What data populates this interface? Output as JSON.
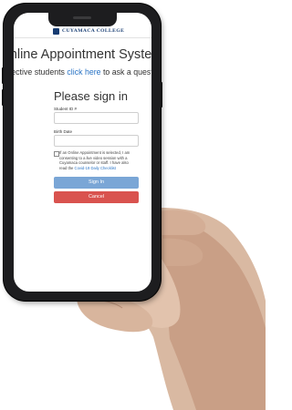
{
  "header": {
    "college_name": "CUYAMACA COLLEGE"
  },
  "page": {
    "system_title": "nline Appointment Syster",
    "prospect_prefix": "pective students ",
    "prospect_link": "click here",
    "prospect_suffix": " to ask a questio"
  },
  "form": {
    "title": "Please sign in",
    "student_id_label": "Student ID #",
    "student_id_value": "",
    "birth_date_label": "Birth Date",
    "birth_date_value": "",
    "consent_text": "If an Online Appointment is selected, I am consenting to a live video session with a Cuyamaca counselor or staff. I have also read the",
    "consent_link": "Covid-19 Daily Checklist",
    "consent_checked": false,
    "signin_label": "Sign In",
    "cancel_label": "Cancel"
  },
  "colors": {
    "link": "#2a74c5",
    "signin_button": "#7aa6d6",
    "cancel_button": "#d9534f",
    "brand": "#173c72"
  }
}
